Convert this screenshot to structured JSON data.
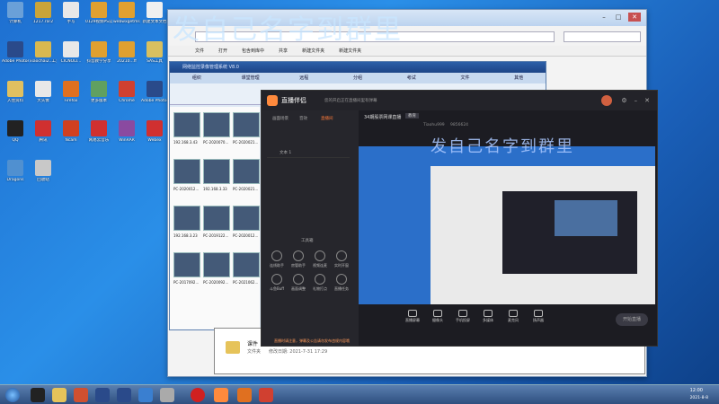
{
  "overlay": {
    "main_text": "发自己名字到群里",
    "preview_text": "发自己名字到群里"
  },
  "desktop_icons": [
    {
      "label": "计算机",
      "color": "#6aa0d8"
    },
    {
      "label": "1217.rar2",
      "color": "#c9a43a"
    },
    {
      "label": "手写",
      "color": "#e8e8e8"
    },
    {
      "label": "0129视频PS公告资料",
      "color": "#e0a030"
    },
    {
      "label": "webwxgetmsgimg",
      "color": "#e0a030"
    },
    {
      "label": "新建文本文档",
      "color": "#f0f0f0"
    },
    {
      "label": "Adobe Photosh...",
      "color": "#2a4a8a"
    },
    {
      "label": "xiaochai2..工资管理",
      "color": "#d8b850"
    },
    {
      "label": "CICNOLI...",
      "color": "#e8e8e8"
    },
    {
      "label": "抖音教学分享",
      "color": "#e0a030"
    },
    {
      "label": "20210...ff",
      "color": "#e0a030"
    },
    {
      "label": "SAS工具",
      "color": "#d8c060"
    },
    {
      "label": "入住资料",
      "color": "#e0c060"
    },
    {
      "label": "大头像",
      "color": "#e8e8e8"
    },
    {
      "label": "Firefox",
      "color": "#e07020"
    },
    {
      "label": "更多版本",
      "color": "#60a060"
    },
    {
      "label": "Chrome",
      "color": "#d04030"
    },
    {
      "label": "Adobe Photoshop",
      "color": "#2a4a8a"
    },
    {
      "label": "QQ",
      "color": "#222222"
    },
    {
      "label": "腾讯",
      "color": "#d03030"
    },
    {
      "label": "Ncam",
      "color": "#d04020"
    },
    {
      "label": "网易云音乐",
      "color": "#d03030"
    },
    {
      "label": "WinRAR",
      "color": "#8a4aa0"
    },
    {
      "label": "Webex",
      "color": "#d03030"
    },
    {
      "label": "Dragons",
      "color": "#5090d0"
    },
    {
      "label": "回收站",
      "color": "#c8c8c8"
    }
  ],
  "explorer": {
    "menu": [
      "文件",
      "打开",
      "包含到库中",
      "共享",
      "新建文件夹",
      "新建文件夹"
    ]
  },
  "manager": {
    "title": "网络监控录像管理系统 V8.0",
    "tabs": [
      "组织",
      "课堂管理",
      "远程",
      "分组",
      "考试",
      "文件",
      "其他"
    ],
    "thumbs": [
      {
        "label": "192.168.3.43"
      },
      {
        "label": "PC-2020070..."
      },
      {
        "label": "PC-2020021..."
      },
      {
        "label": "PC-2020012..."
      },
      {
        "label": "192.168.3.33"
      },
      {
        "label": "PC-2020021..."
      },
      {
        "label": "192.168.3.23"
      },
      {
        "label": "PC-2019122..."
      },
      {
        "label": "PC-2020012..."
      },
      {
        "label": "PC-2017092..."
      },
      {
        "label": "PC-2020092..."
      },
      {
        "label": "PC-2021062..."
      }
    ]
  },
  "live": {
    "app_name": "直播伴侣",
    "notice": "您的开启正在直播间里有弹幕",
    "room_title": "34期股票网课直播",
    "tag": "教育",
    "user": "Tiaohu999",
    "id_text": "9856624",
    "sidebar_tabs": [
      "画面场景",
      "音效",
      "直播间"
    ],
    "scene_label": "文本 1",
    "tools_label": "工具箱",
    "tools": [
      "连线助手",
      "房管助手",
      "视频连麦",
      "实时开窗",
      "斗鱼Buff",
      "画面调整",
      "礼物打点",
      "直播任务"
    ],
    "bottom_buttons": [
      "直播屏幕",
      "摄像头",
      "手机投屏",
      "多媒体",
      "麦克风",
      "扬声器"
    ],
    "start_button": "开始直播",
    "footer_note": "直播时请注意，弹幕及公告请勿发布违规内容哦"
  },
  "dialog": {
    "item_name": "课件",
    "item_type": "文件夹",
    "modified": "修改日期: 2021-7-31 17:29"
  },
  "taskbar": {
    "time": "12:00",
    "date": "2021-8-8"
  }
}
